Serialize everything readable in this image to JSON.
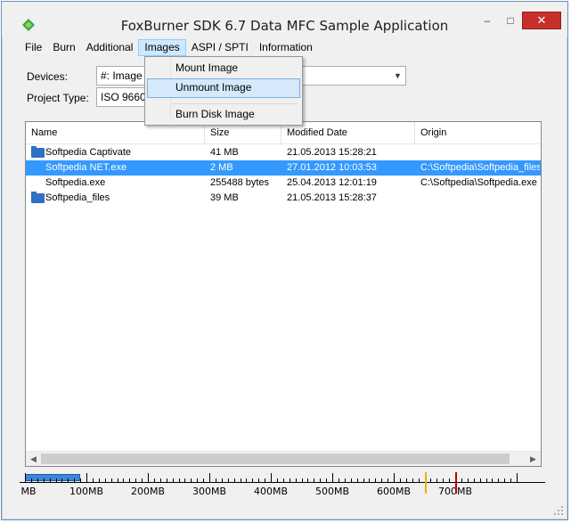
{
  "window": {
    "title": "FoxBurner SDK 6.7 Data MFC Sample Application",
    "controls": {
      "minimize": "–",
      "maximize": "□",
      "close": "✕"
    }
  },
  "menubar": {
    "items": [
      "File",
      "Burn",
      "Additional",
      "Images",
      "ASPI / SPTI",
      "Information"
    ]
  },
  "form": {
    "devices_label": "Devices:",
    "devices_value": "#: Image",
    "project_type_label": "Project Type:",
    "project_type_value": "ISO 9660"
  },
  "images_menu": {
    "items": [
      "Mount Image",
      "Unmount Image",
      "Burn Disk Image"
    ]
  },
  "file_list": {
    "columns": [
      "Name",
      "Size",
      "Modified Date",
      "Origin"
    ],
    "rows": [
      {
        "name": "Softpedia Captivate",
        "size": "41 MB",
        "modified": "21.05.2013 15:28:21",
        "origin": "",
        "is_folder": true,
        "selected": false
      },
      {
        "name": "Softpedia NET.exe",
        "size": "2 MB",
        "modified": "27.01.2012 10:03:53",
        "origin": "C:\\Softpedia\\Softpedia_files",
        "is_folder": false,
        "selected": true
      },
      {
        "name": "Softpedia.exe",
        "size": "255488 bytes",
        "modified": "25.04.2013 12:01:19",
        "origin": "C:\\Softpedia\\Softpedia.exe",
        "is_folder": false,
        "selected": false
      },
      {
        "name": "Softpedia_files",
        "size": "39 MB",
        "modified": "21.05.2013 15:28:37",
        "origin": "",
        "is_folder": true,
        "selected": false
      }
    ]
  },
  "ruler": {
    "labels": [
      "MB",
      "100MB",
      "200MB",
      "300MB",
      "400MB",
      "500MB",
      "600MB",
      "700MB"
    ],
    "used_mb": 90,
    "marks": [
      {
        "mb": 650,
        "color": "#e5b400"
      },
      {
        "mb": 700,
        "color": "#c00000"
      }
    ]
  },
  "colors": {
    "selection": "#3399ff",
    "folder": "#2f6fc4",
    "close_button": "#c7302a",
    "capacity_bar": "#3c86d8"
  }
}
